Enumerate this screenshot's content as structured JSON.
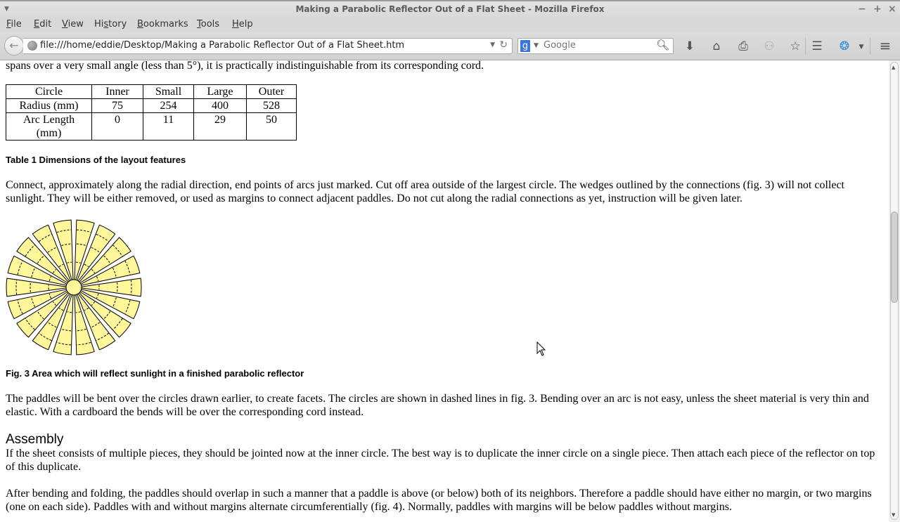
{
  "window": {
    "title": "Making a Parabolic Reflector Out of a Flat Sheet - Mozilla Firefox",
    "controls": {
      "minimize": "−",
      "maximize": "+",
      "close": "×"
    }
  },
  "menubar": {
    "items": [
      {
        "label": "File",
        "access": "F",
        "rest": "ile"
      },
      {
        "label": "Edit",
        "access": "E",
        "rest": "dit"
      },
      {
        "label": "View",
        "access": "V",
        "rest": "iew"
      },
      {
        "label": "History",
        "pre": "Hi",
        "access": "s",
        "rest": "tory"
      },
      {
        "label": "Bookmarks",
        "access": "B",
        "rest": "ookmarks"
      },
      {
        "label": "Tools",
        "access": "T",
        "rest": "ools"
      },
      {
        "label": "Help",
        "access": "H",
        "rest": "elp"
      }
    ]
  },
  "navbar": {
    "url": "file:///home/eddie/Desktop/Making a Parabolic Reflector Out of a Flat Sheet.htm",
    "search_engine": "Google",
    "search_placeholder": "Google",
    "icons": [
      "back-icon",
      "globe-icon",
      "url-dropdown-icon",
      "reload-icon",
      "google-icon",
      "search-icon",
      "download-icon",
      "home-icon",
      "print-icon",
      "addon-icon",
      "bookmark-star-icon",
      "bookmarks-list-icon",
      "extension-icon",
      "menu-icon"
    ]
  },
  "content": {
    "intro_line": "spans over a very small angle (less than 5°), it is practically indistinguishable from its corresponding cord.",
    "table": {
      "headers": [
        "Circle",
        "Inner",
        "Small",
        "Large",
        "Outer"
      ],
      "rows": [
        [
          "Radius (mm)",
          "75",
          "254",
          "400",
          "528"
        ],
        [
          "Arc Length (mm)",
          "0",
          "11",
          "29",
          "50"
        ]
      ],
      "row2_label_line1": "Arc Length",
      "row2_label_line2": "(mm)"
    },
    "table_caption": "Table 1  Dimensions of the layout features",
    "para_connect": "Connect, approximately along the radial direction, end points of arcs just marked.   Cut off area outside of the largest circle. The wedges outlined by the connections (fig. 3) will not collect sunlight. They will be either removed, or used as margins to connect adjacent paddles.  Do not cut along the radial connections as yet, instruction will be given later.",
    "figure": {
      "paddle_count": 18,
      "fill_color": "#fff799",
      "stroke_color": "#000000"
    },
    "figure_caption": "Fig. 3  Area which will reflect sunlight in a finished parabolic reflector",
    "para_paddles": "The paddles will be bent over the circles drawn earlier, to create facets.  The circles are shown in dashed lines in fig. 3.  Bending over an arc is not easy, unless the sheet material is very thin and elastic.  With a cardboard the bends will be over the corresponding cord instead.",
    "heading_assembly": "Assembly",
    "para_assembly": "If the sheet consists of multiple pieces, they should be jointed now at the inner circle.  The best way is to duplicate the inner circle on a single piece.  Then attach each piece of the reflector on top of this duplicate.",
    "para_overlap": "After bending and folding, the paddles should overlap in such a manner that a paddle is above (or below) both of its neighbors.  Therefore a paddle should have either no margin, or two margins (one on each side).  Paddles with and without margins alternate circumferentially (fig. 4).  Normally, paddles with margins will be below paddles without margins."
  },
  "scrollbar": {
    "position_fraction": 0.33
  }
}
